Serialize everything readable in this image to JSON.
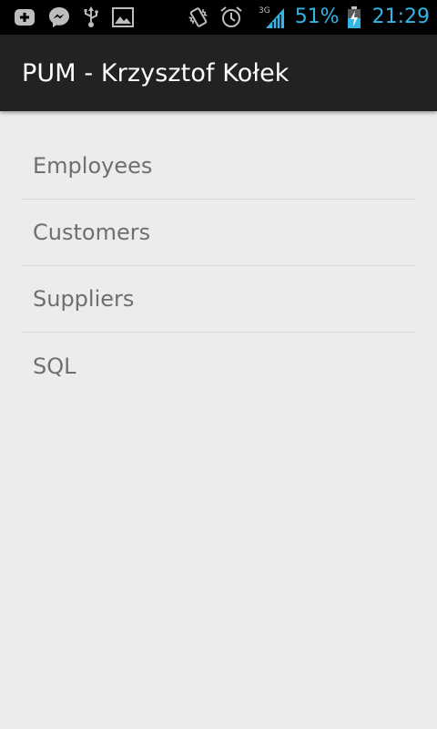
{
  "status_bar": {
    "left_icons": [
      "add-notification-icon",
      "messenger-icon",
      "usb-icon",
      "image-icon"
    ],
    "right_icons": [
      "vibrate-icon",
      "alarm-icon",
      "signal-3g-icon",
      "battery-charging-icon"
    ],
    "network_type": "3G",
    "battery_percent": "51%",
    "time": "21:29",
    "accent_color": "#33b5e5"
  },
  "action_bar": {
    "title": "PUM - Krzysztof Kołek"
  },
  "menu": {
    "items": [
      {
        "label": "Employees"
      },
      {
        "label": "Customers"
      },
      {
        "label": "Suppliers"
      },
      {
        "label": "SQL"
      }
    ]
  }
}
